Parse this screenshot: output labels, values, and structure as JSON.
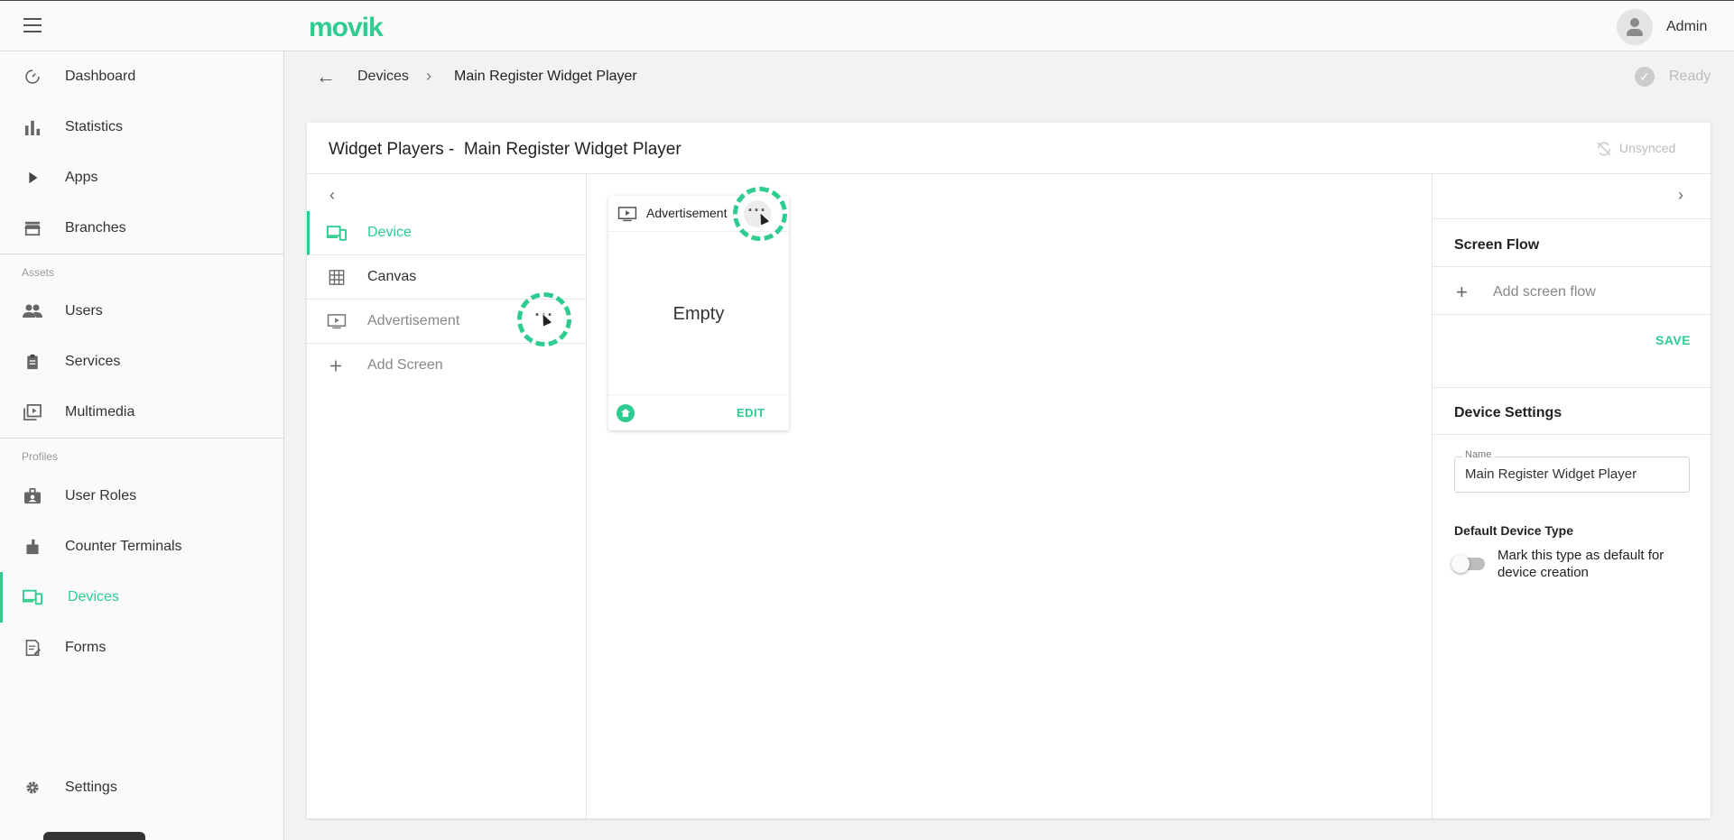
{
  "app": {
    "logo": "movik",
    "user": "Admin"
  },
  "sidebar": {
    "items": [
      {
        "label": "Dashboard",
        "icon": "dashboard-icon"
      },
      {
        "label": "Statistics",
        "icon": "bar-chart-icon"
      },
      {
        "label": "Apps",
        "icon": "play-icon"
      },
      {
        "label": "Branches",
        "icon": "store-icon"
      },
      {
        "label": "Users",
        "icon": "people-icon"
      },
      {
        "label": "Services",
        "icon": "clipboard-icon"
      },
      {
        "label": "Multimedia",
        "icon": "video-library-icon"
      },
      {
        "label": "User Roles",
        "icon": "badge-icon"
      },
      {
        "label": "Counter Terminals",
        "icon": "terminal-icon"
      },
      {
        "label": "Devices",
        "icon": "devices-icon",
        "active": true
      },
      {
        "label": "Forms",
        "icon": "form-icon"
      },
      {
        "label": "Settings",
        "icon": "gear-icon"
      }
    ],
    "section_assets": "Assets",
    "section_profiles": "Profiles"
  },
  "breadcrumb": {
    "parent": "Devices",
    "current": "Main Register Widget Player"
  },
  "status": {
    "ready": "Ready",
    "sync": "Unsynced"
  },
  "card": {
    "title": "Widget Players -  Main Register Widget Player"
  },
  "screens": {
    "items": [
      {
        "label": "Device",
        "icon": "devices-icon",
        "active": true
      },
      {
        "label": "Canvas",
        "icon": "grid-icon"
      },
      {
        "label": "Advertisement",
        "icon": "tv-play-icon"
      }
    ],
    "add_label": "Add Screen",
    "more_label": "···"
  },
  "preview": {
    "title": "Advertisement",
    "body": "Empty",
    "edit_label": "EDIT",
    "more_label": "···"
  },
  "right_panel": {
    "screen_flow_title": "Screen Flow",
    "add_flow_label": "Add screen flow",
    "save_label": "SAVE",
    "device_settings_title": "Device Settings",
    "name_label": "Name",
    "name_value": "Main Register Widget Player",
    "default_type_title": "Default Device Type",
    "default_toggle_label": "Mark this type as default for device creation",
    "default_toggle_on": false
  },
  "colors": {
    "accent": "#2ecc8f",
    "text": "#333333",
    "muted": "#888888"
  }
}
